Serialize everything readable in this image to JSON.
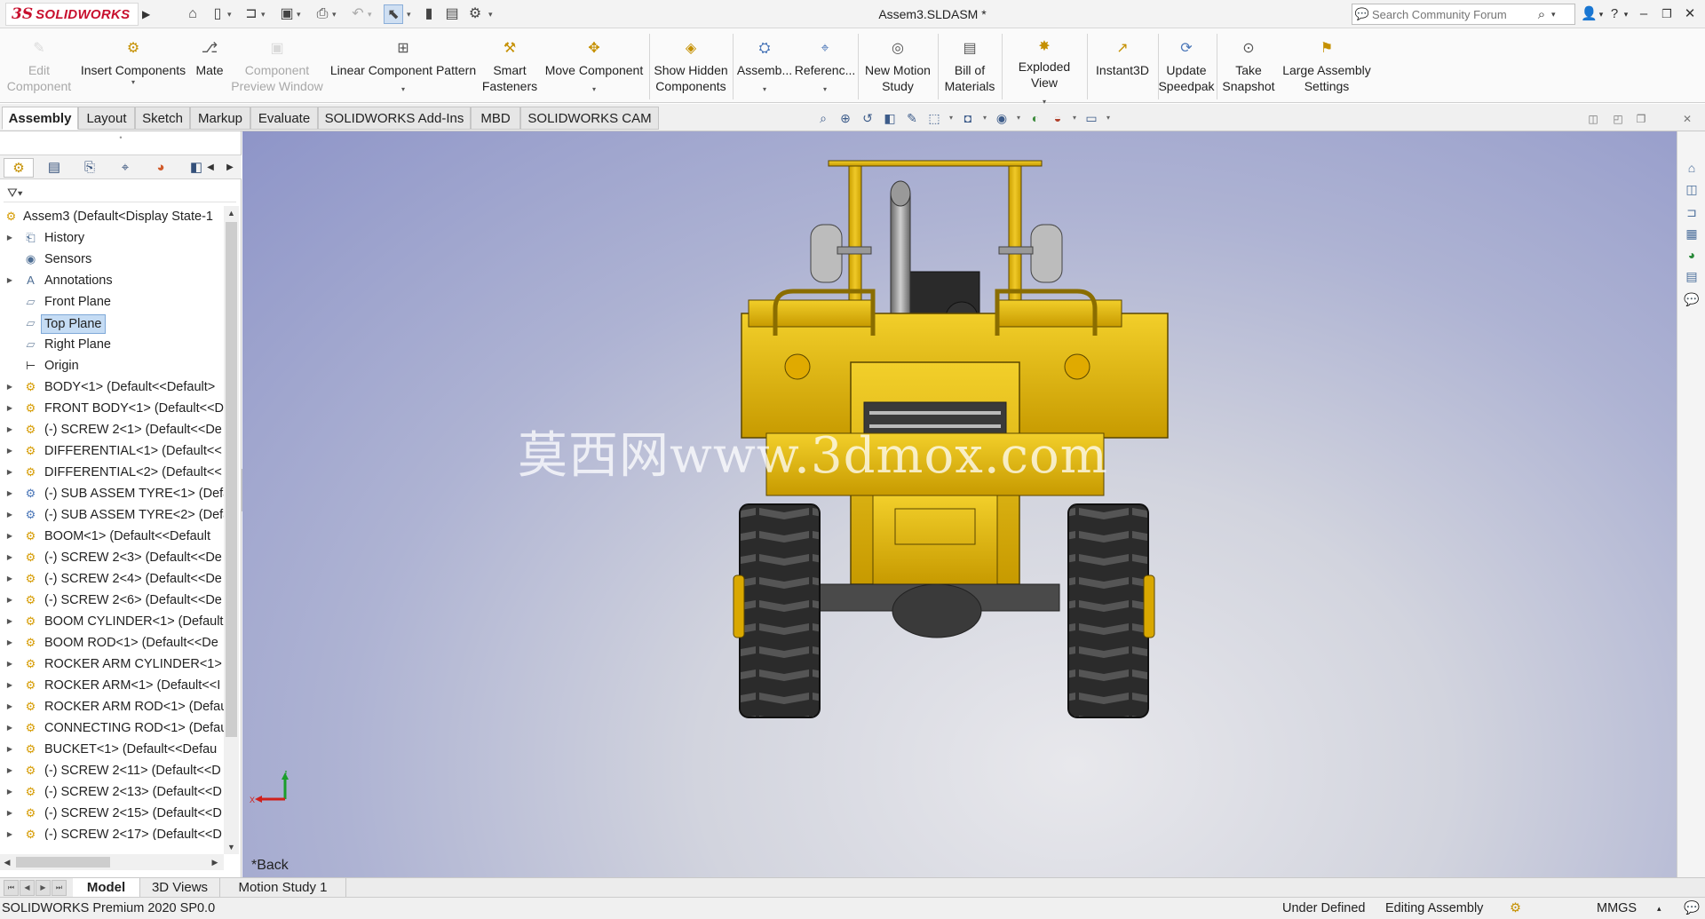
{
  "titlebar": {
    "logo_ds": "3S",
    "logo_text": "SOLIDWORKS",
    "document_title": "Assem3.SLDASM *",
    "search_placeholder": "Search Community Forum"
  },
  "ribbon": {
    "buttons": [
      {
        "label1": "Edit",
        "label2": "Component",
        "icon": "edit-component-icon",
        "glyph": "✎",
        "disabled": true
      },
      {
        "label1": "Insert Components",
        "label2": "",
        "icon": "insert-components-icon",
        "glyph": "⚙",
        "disabled": false,
        "caret": true
      },
      {
        "label1": "Mate",
        "label2": "",
        "icon": "mate-icon",
        "glyph": "📎",
        "disabled": false
      },
      {
        "label1": "Component",
        "label2": "Preview Window",
        "icon": "component-preview-icon",
        "glyph": "▣",
        "disabled": true
      },
      {
        "label1": "Linear Component Pattern",
        "label2": "",
        "icon": "linear-pattern-icon",
        "glyph": "⊞",
        "disabled": false,
        "caret": true
      },
      {
        "label1": "Smart",
        "label2": "Fasteners",
        "icon": "smart-fasteners-icon",
        "glyph": "⚒",
        "disabled": false
      },
      {
        "label1": "Move Component",
        "label2": "",
        "icon": "move-component-icon",
        "glyph": "✥",
        "disabled": false,
        "caret": true
      },
      {
        "label1": "Show Hidden",
        "label2": "Components",
        "icon": "show-hidden-icon",
        "glyph": "◈",
        "disabled": false
      },
      {
        "label1": "Assemb...",
        "label2": "",
        "icon": "assembly-features-icon",
        "glyph": "⛭",
        "disabled": false,
        "caret": true
      },
      {
        "label1": "Referenc...",
        "label2": "",
        "icon": "reference-geometry-icon",
        "glyph": "⌖",
        "disabled": false,
        "caret": true
      },
      {
        "label1": "New Motion",
        "label2": "Study",
        "icon": "motion-study-icon",
        "glyph": "◎",
        "disabled": false
      },
      {
        "label1": "Bill of",
        "label2": "Materials",
        "icon": "bill-of-materials-icon",
        "glyph": "▤",
        "disabled": false
      },
      {
        "label1": "Exploded View",
        "label2": "",
        "icon": "exploded-view-icon",
        "glyph": "✸",
        "disabled": false,
        "caret": true
      },
      {
        "label1": "Instant3D",
        "label2": "",
        "icon": "instant3d-icon",
        "glyph": "↗",
        "disabled": false
      },
      {
        "label1": "Update",
        "label2": "Speedpak",
        "icon": "update-speedpak-icon",
        "glyph": "⟳",
        "disabled": false
      },
      {
        "label1": "Take",
        "label2": "Snapshot",
        "icon": "snapshot-icon",
        "glyph": "📷",
        "disabled": false
      },
      {
        "label1": "Large Assembly",
        "label2": "Settings",
        "icon": "large-assembly-icon",
        "glyph": "⚑",
        "disabled": false
      }
    ]
  },
  "cm_tabs": [
    "Assembly",
    "Layout",
    "Sketch",
    "Markup",
    "Evaluate",
    "SOLIDWORKS Add-Ins",
    "MBD",
    "SOLIDWORKS CAM"
  ],
  "tree": {
    "root": "Assem3  (Default<Display State-1",
    "items": [
      {
        "label": "History",
        "icon": "history",
        "expandable": true
      },
      {
        "label": "Sensors",
        "icon": "sensors",
        "expandable": false
      },
      {
        "label": "Annotations",
        "icon": "annotations",
        "expandable": true
      },
      {
        "label": "Front Plane",
        "icon": "plane",
        "expandable": false
      },
      {
        "label": "Top Plane",
        "icon": "plane",
        "expandable": false,
        "selected": true
      },
      {
        "label": "Right Plane",
        "icon": "plane",
        "expandable": false
      },
      {
        "label": "Origin",
        "icon": "origin",
        "expandable": false
      },
      {
        "label": "BODY<1> (Default<<Default>",
        "icon": "component",
        "expandable": true
      },
      {
        "label": "FRONT BODY<1> (Default<<D",
        "icon": "component",
        "expandable": true
      },
      {
        "label": "(-) SCREW 2<1> (Default<<De",
        "icon": "component",
        "expandable": true
      },
      {
        "label": "DIFFERENTIAL<1> (Default<<",
        "icon": "component",
        "expandable": true
      },
      {
        "label": "DIFFERENTIAL<2> (Default<<",
        "icon": "component",
        "expandable": true
      },
      {
        "label": "(-) SUB ASSEM TYRE<1> (Defa",
        "icon": "subassembly",
        "expandable": true
      },
      {
        "label": "(-) SUB ASSEM TYRE<2> (Defa",
        "icon": "subassembly",
        "expandable": true
      },
      {
        "label": "BOOM<1> (Default<<Default",
        "icon": "component",
        "expandable": true
      },
      {
        "label": "(-) SCREW 2<3> (Default<<De",
        "icon": "component",
        "expandable": true
      },
      {
        "label": "(-) SCREW 2<4> (Default<<De",
        "icon": "component",
        "expandable": true
      },
      {
        "label": "(-) SCREW 2<6> (Default<<De",
        "icon": "component",
        "expandable": true
      },
      {
        "label": "BOOM CYLINDER<1> (Default",
        "icon": "component",
        "expandable": true
      },
      {
        "label": "BOOM ROD<1> (Default<<De",
        "icon": "component",
        "expandable": true
      },
      {
        "label": "ROCKER ARM CYLINDER<1> (",
        "icon": "component",
        "expandable": true
      },
      {
        "label": "ROCKER ARM<1> (Default<<I",
        "icon": "component",
        "expandable": true
      },
      {
        "label": "ROCKER ARM ROD<1> (Defau",
        "icon": "component",
        "expandable": true
      },
      {
        "label": "CONNECTING ROD<1> (Defau",
        "icon": "component",
        "expandable": true
      },
      {
        "label": "BUCKET<1> (Default<<Defau",
        "icon": "component",
        "expandable": true
      },
      {
        "label": "(-) SCREW 2<11> (Default<<D",
        "icon": "component",
        "expandable": true
      },
      {
        "label": "(-) SCREW 2<13> (Default<<D",
        "icon": "component",
        "expandable": true
      },
      {
        "label": "(-) SCREW 2<15> (Default<<D",
        "icon": "component",
        "expandable": true
      },
      {
        "label": "(-) SCREW 2<17> (Default<<D",
        "icon": "component",
        "expandable": true
      }
    ]
  },
  "viewport": {
    "watermark": "莫西网www.3dmox.com",
    "view_label": "*Back",
    "triad_x": "X",
    "triad_y": "Y"
  },
  "bottom_tabs": [
    "Model",
    "3D Views",
    "Motion Study 1"
  ],
  "status": {
    "product": "SOLIDWORKS Premium 2020 SP0.0",
    "definition": "Under Defined",
    "mode": "Editing Assembly",
    "units": "MMGS"
  },
  "colors": {
    "brand_red": "#c8102e",
    "machine_yellow": "#e8b800",
    "selection_blue": "#c5dcf4"
  }
}
